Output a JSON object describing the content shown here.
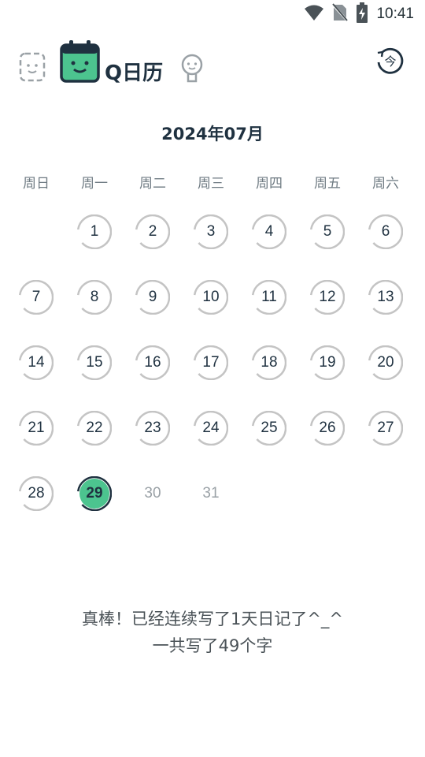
{
  "status_bar": {
    "time": "10:41",
    "icons": [
      "wifi-icon",
      "no-sim-icon",
      "battery-charging-icon"
    ]
  },
  "toolbar": {
    "app_title": "Q日历",
    "icons": [
      "diary-face-icon",
      "calendar-face-icon",
      "profile-face-icon",
      "today-icon"
    ],
    "today_label": "今"
  },
  "calendar": {
    "month_title": "2024年07月",
    "weekdays": [
      "周日",
      "周一",
      "周二",
      "周三",
      "周四",
      "周五",
      "周六"
    ],
    "start_weekday": 1,
    "days": [
      "1",
      "2",
      "3",
      "4",
      "5",
      "6",
      "7",
      "8",
      "9",
      "10",
      "11",
      "12",
      "13",
      "14",
      "15",
      "16",
      "17",
      "18",
      "19",
      "20",
      "21",
      "22",
      "23",
      "24",
      "25",
      "26",
      "27",
      "28",
      "29",
      "30",
      "31"
    ],
    "today": 29,
    "colors": {
      "accent": "#4cc48f",
      "ring": "#c4c4c4",
      "dark": "#1f3140",
      "future": "#9aa1a6"
    }
  },
  "summary": {
    "line1": "真棒！已经连续写了1天日记了^_^",
    "line2": "一共写了49个字"
  }
}
